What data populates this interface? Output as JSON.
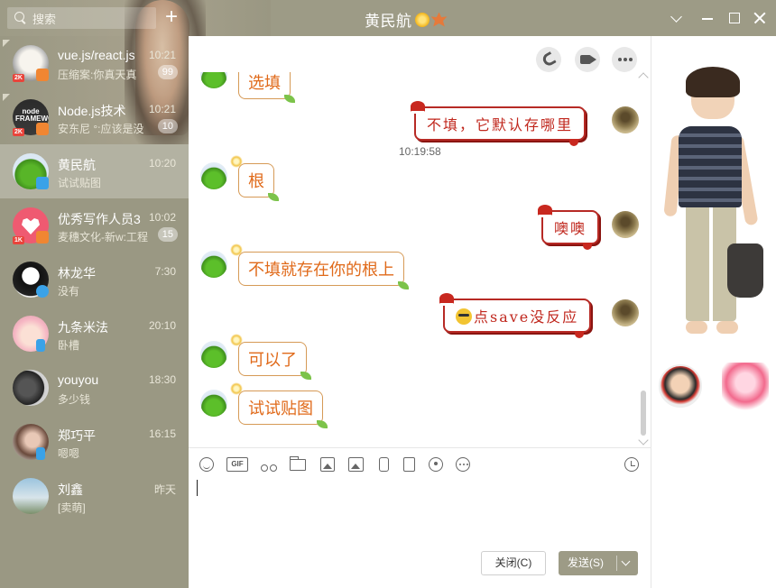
{
  "search": {
    "placeholder": "搜索"
  },
  "window": {
    "title": "黄民航"
  },
  "conversations": [
    {
      "name": "vue.js/react.js",
      "preview": "压缩案:你真天真",
      "time": "10:21",
      "count": "99"
    },
    {
      "name": "Node.js技术",
      "preview": "安东尼 °:应该是没",
      "time": "10:21",
      "count": "10"
    },
    {
      "name": "黄民航",
      "preview": "试试贴图",
      "time": "10:20",
      "count": ""
    },
    {
      "name": "优秀写作人员3",
      "preview": "麦穗文化-新w:工程",
      "time": "10:02",
      "count": "15"
    },
    {
      "name": "林龙华",
      "preview": "没有",
      "time": "7:30",
      "count": ""
    },
    {
      "name": "九条米法",
      "preview": "卧槽",
      "time": "20:10",
      "count": ""
    },
    {
      "name": "youyou",
      "preview": "多少钱",
      "time": "18:30",
      "count": ""
    },
    {
      "name": "郑巧平",
      "preview": "嗯嗯",
      "time": "16:15",
      "count": ""
    },
    {
      "name": "刘鑫",
      "preview": "[卖萌]",
      "time": "昨天",
      "count": ""
    }
  ],
  "messages": [
    {
      "side": "left",
      "text": "选填"
    },
    {
      "side": "right",
      "text": "不填，它默认存哪里"
    },
    {
      "side": "left",
      "text": "根"
    },
    {
      "side": "right",
      "text": "噢噢"
    },
    {
      "side": "left",
      "text": "不填就存在你的根上"
    },
    {
      "side": "right",
      "text": "点save没反应"
    },
    {
      "side": "left",
      "text": "可以了"
    },
    {
      "side": "left",
      "text": "试试贴图"
    }
  ],
  "timestamp": "10:19:58",
  "toolbar": {
    "gif_label": "GIF"
  },
  "buttons": {
    "close": "关闭(C)",
    "send": "发送(S)"
  },
  "theme": {
    "sidebar": "#9d9b86",
    "bubble_left_border": "#d69a56",
    "bubble_left_text": "#e06a1a",
    "bubble_right_border": "#b72a25",
    "bubble_right_text": "#c0271d"
  },
  "icons": [
    "search-icon",
    "add-icon",
    "phone-icon",
    "video-icon",
    "more-icon",
    "emoji-icon",
    "gif-icon",
    "scissors-icon",
    "folder-icon",
    "image-icon",
    "shake-icon",
    "red-packet-icon",
    "music-icon",
    "more-tools-icon",
    "history-clock-icon"
  ]
}
